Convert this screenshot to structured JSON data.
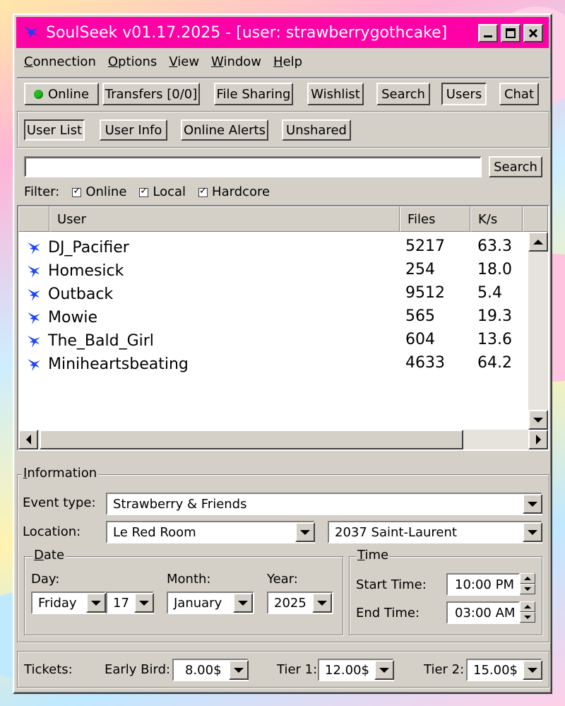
{
  "window": {
    "title": "SoulSeek v01.17.2025  -  [user: strawberrygothcake]",
    "accent": "#ff00a6"
  },
  "menu": [
    "Connection",
    "Options",
    "View",
    "Window",
    "Help"
  ],
  "toolbar": {
    "online": "Online",
    "transfers": "Transfers [0/0]",
    "file_sharing": "File Sharing",
    "wishlist": "Wishlist",
    "search": "Search",
    "users": "Users",
    "chat": "Chat",
    "online_color": "#22bb22"
  },
  "subtabs": {
    "user_list": "User List",
    "user_info": "User Info",
    "online_alerts": "Online Alerts",
    "unshared": "Unshared"
  },
  "search": {
    "value": "",
    "button": "Search"
  },
  "filter": {
    "label": "Filter:",
    "online": "Online",
    "local": "Local",
    "hardcore": "Hardcore"
  },
  "columns": {
    "user": "User",
    "files": "Files",
    "speed": "K/s"
  },
  "users": [
    {
      "name": "DJ_Pacifier",
      "files": "5217",
      "speed": "63.3",
      "icon": "soulseek-bird-icon"
    },
    {
      "name": "Homesick",
      "files": "254",
      "speed": "18.0",
      "icon": "soulseek-bird-icon"
    },
    {
      "name": "Outback",
      "files": "9512",
      "speed": "5.4",
      "icon": "soulseek-bird-icon"
    },
    {
      "name": "Mowie",
      "files": "565",
      "speed": "19.3",
      "icon": "soulseek-bird-icon"
    },
    {
      "name": "The_Bald_Girl",
      "files": "604",
      "speed": "13.6",
      "icon": "soulseek-bird-icon"
    },
    {
      "name": "Miniheartsbeating",
      "files": "4633",
      "speed": "64.2",
      "icon": "soulseek-bird-icon"
    }
  ],
  "info": {
    "legend": "Information",
    "event_type_label": "Event type:",
    "event_type": "Strawberry & Friends",
    "location_label": "Location:",
    "location": "Le Red Room",
    "address": "2037 Saint-Laurent",
    "date_legend": "Date",
    "day_label": "Day:",
    "day": "Friday",
    "day_num": "17",
    "month_label": "Month:",
    "month": "January",
    "year_label": "Year:",
    "year": "2025",
    "time_legend": "Time",
    "start_label": "Start Time:",
    "start": "10:00 PM",
    "end_label": "End Time:",
    "end": "03:00 AM"
  },
  "tickets": {
    "label": "Tickets:",
    "early_label": "Early Bird:",
    "early": "8.00$",
    "tier1_label": "Tier 1:",
    "tier1": "12.00$",
    "tier2_label": "Tier 2:",
    "tier2": "15.00$"
  }
}
